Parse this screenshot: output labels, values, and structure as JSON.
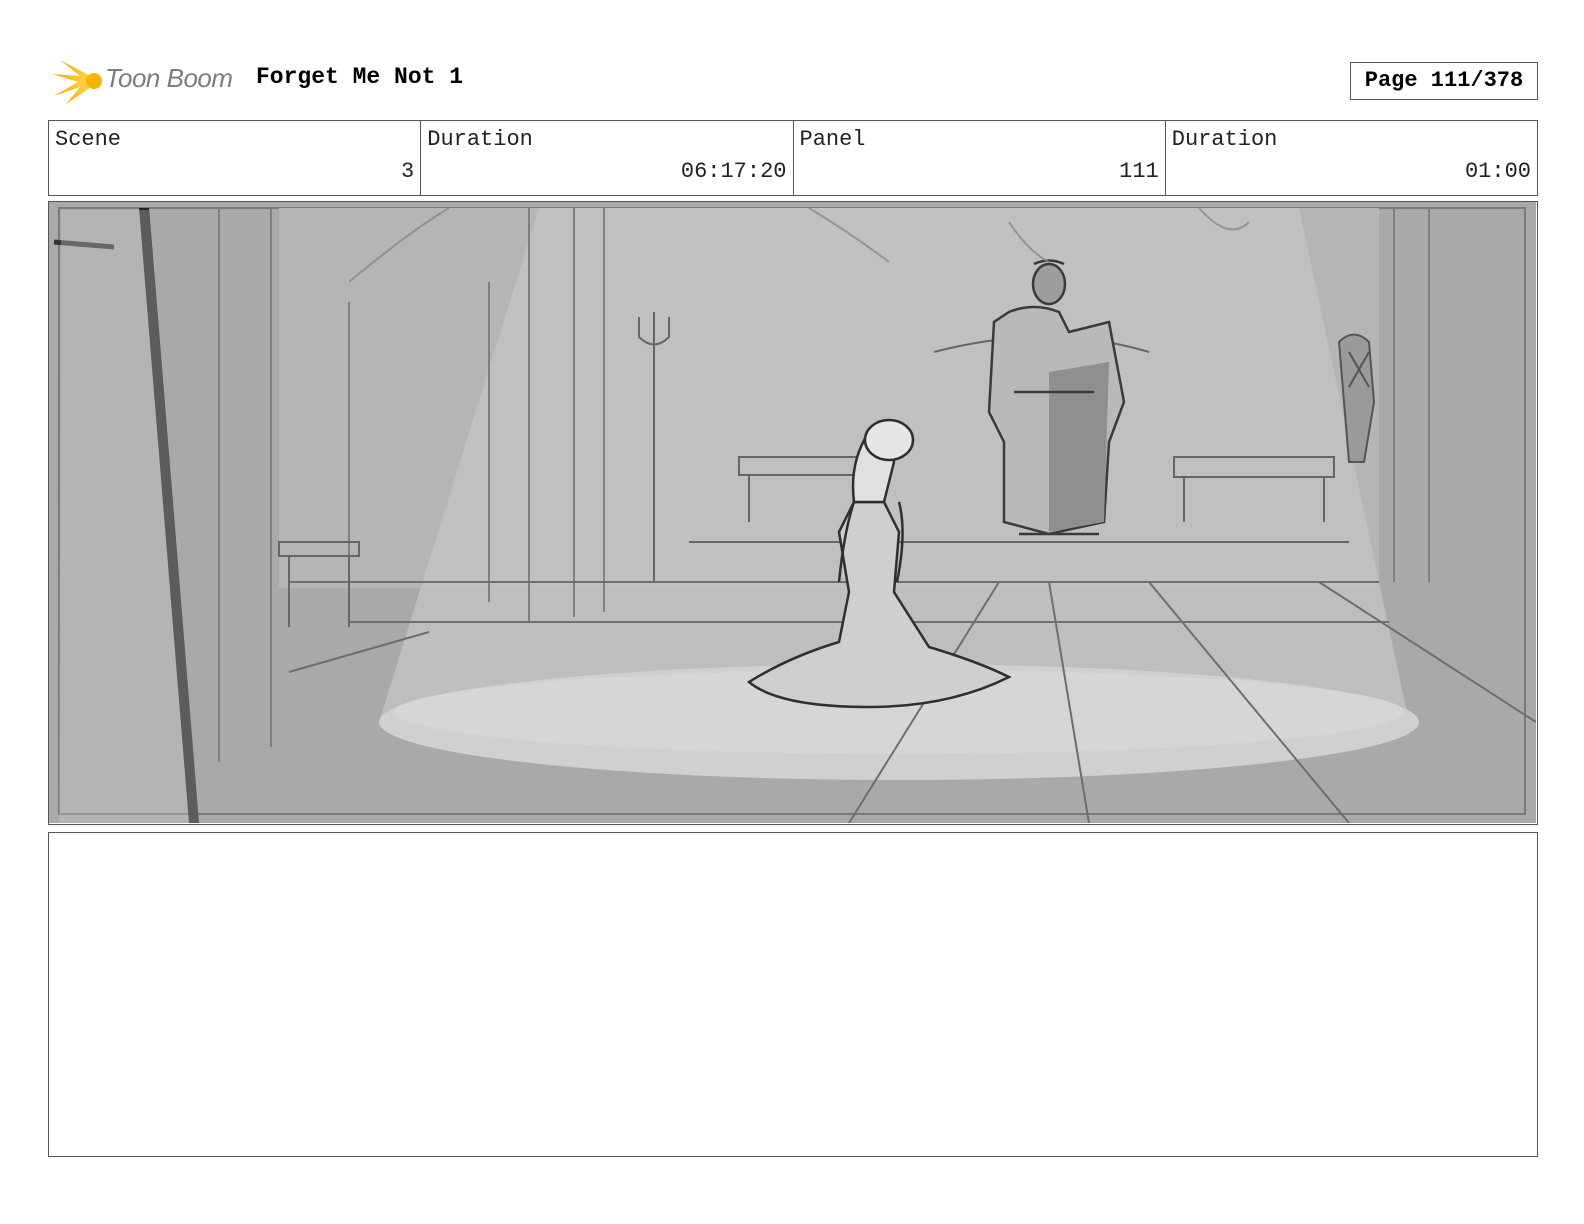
{
  "header": {
    "logo_text": "Toon Boom",
    "project_title": "Forget Me Not 1",
    "page_label": "Page 111/378"
  },
  "info": {
    "scene_label": "Scene",
    "scene_value": "3",
    "scene_duration_label": "Duration",
    "scene_duration_value": "06:17:20",
    "panel_label": "Panel",
    "panel_value": "111",
    "panel_duration_label": "Duration",
    "panel_duration_value": "01:00"
  },
  "panel": {
    "description": ""
  },
  "notes": {
    "text": ""
  }
}
